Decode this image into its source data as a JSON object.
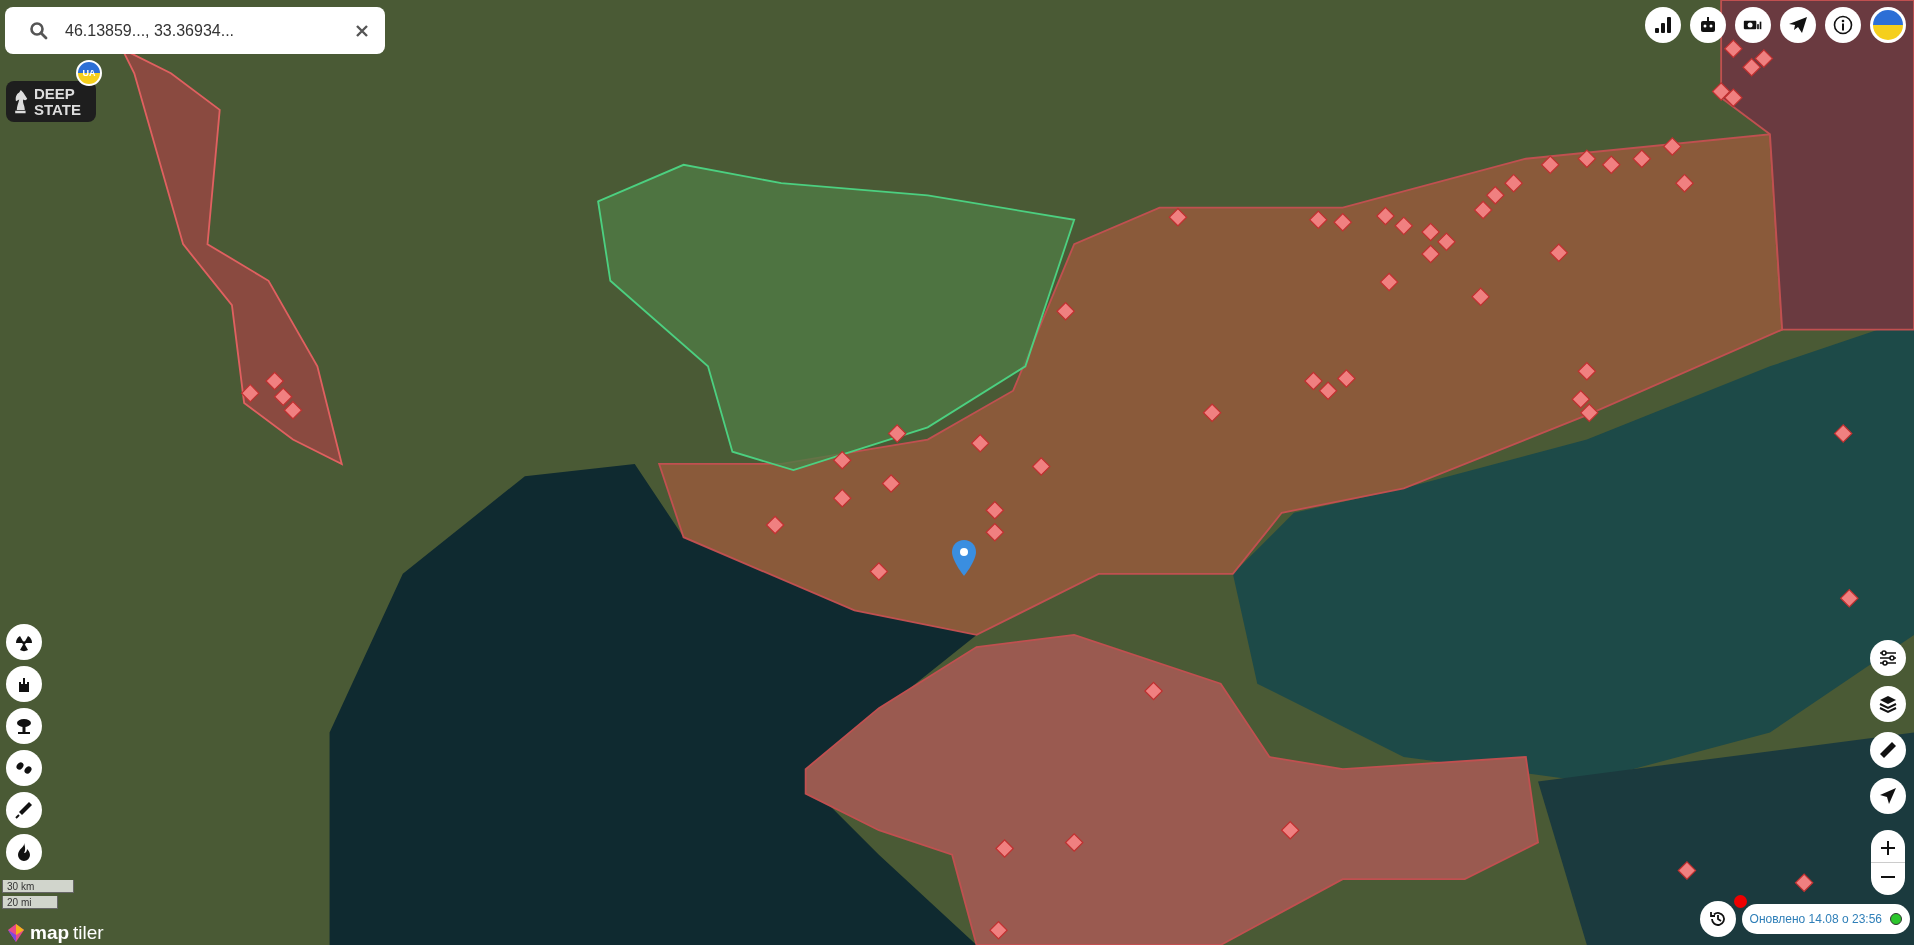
{
  "search": {
    "value": "46.13859..., 33.36934..."
  },
  "logo": {
    "lines": [
      "DEEP",
      "STATE"
    ],
    "badge": "UA"
  },
  "scale": [
    "30 km",
    "20 mi"
  ],
  "attribution": {
    "map": "map",
    "tiler": "tiler"
  },
  "status": {
    "text": "Оновлено 14.08 о 23:56",
    "online": true,
    "alert": true
  }
}
